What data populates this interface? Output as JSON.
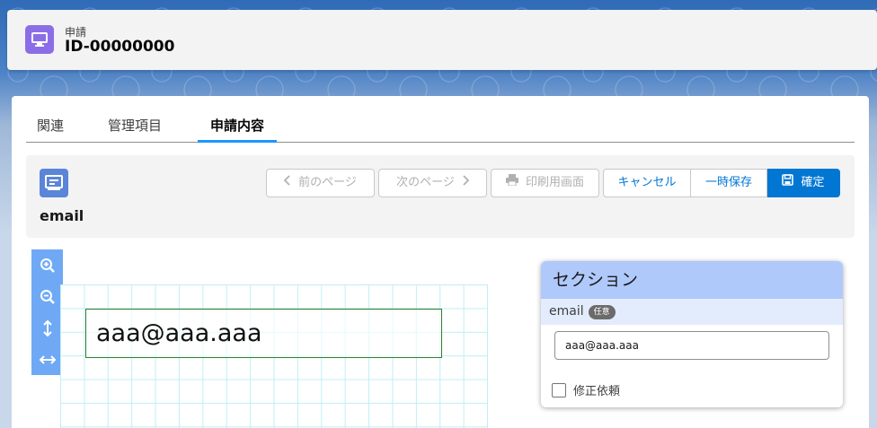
{
  "record": {
    "type_label": "申請",
    "id": "ID-00000000"
  },
  "tabs": [
    {
      "label": "関連"
    },
    {
      "label": "管理項目"
    },
    {
      "label": "申請内容",
      "active": true
    }
  ],
  "form": {
    "title": "email"
  },
  "toolbar": {
    "prev_page": "前のページ",
    "next_page": "次のページ",
    "print": "印刷用画面",
    "cancel": "キャンセル",
    "save_draft": "一時保存",
    "confirm": "確定"
  },
  "viewer": {
    "field_value": "aaa@aaa.aaa"
  },
  "section": {
    "title": "セクション",
    "field_label": "email",
    "optional_badge": "任意",
    "field_value": "aaa@aaa.aaa",
    "checkbox_label": "修正依頼",
    "checkbox_checked": false
  },
  "colors": {
    "brand": "#0176d3",
    "record_icon": "#8c6de8",
    "form_icon": "#5a85d8",
    "zoom_bar": "#6fa9f5",
    "section_header": "#b0c9fb"
  },
  "icons": [
    "monitor-icon",
    "form-icon",
    "chevron-left-icon",
    "chevron-right-icon",
    "print-icon",
    "save-icon",
    "zoom-in-icon",
    "zoom-out-icon",
    "fit-height-icon",
    "fit-width-icon"
  ]
}
